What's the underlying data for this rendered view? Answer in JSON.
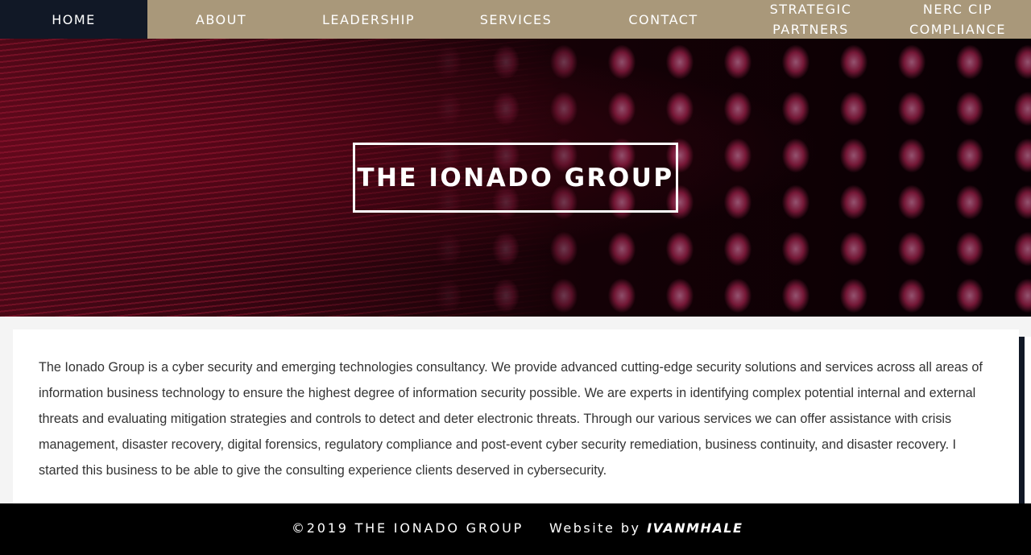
{
  "nav": {
    "items": [
      {
        "label": "HOME",
        "active": true
      },
      {
        "label": "ABOUT"
      },
      {
        "label": "LEADERSHIP"
      },
      {
        "label": "SERVICES"
      },
      {
        "label": "CONTACT"
      },
      {
        "label": "STRATEGIC PARTNERS"
      },
      {
        "label": "NERC CIP COMPLIANCE"
      }
    ]
  },
  "hero": {
    "title": "THE IONADO GROUP"
  },
  "about": {
    "text": "The Ionado Group is a cyber security and emerging technologies consultancy. We provide advanced cutting-edge security solutions and services across all areas of information business technology to ensure the highest degree of information security possible. We are experts in identifying complex potential internal and external threats and evaluating mitigation strategies and controls to detect and deter electronic threats. Through our various services we can offer assistance with crisis management, disaster recovery, digital forensics, regulatory compliance and post-event cyber security remediation, business continuity, and disaster recovery. I started this business to be able to give the consulting experience clients deserved in cybersecurity."
  },
  "footer": {
    "copyright": "©2019 THE IONADO GROUP",
    "credit_prefix": "Website by ",
    "credit_author": "IVANMHALE"
  },
  "colors": {
    "nav_bg": "#a9987a",
    "nav_active_bg": "#111826",
    "footer_bg": "#000000",
    "hero_accent": "#8a0f2e"
  }
}
